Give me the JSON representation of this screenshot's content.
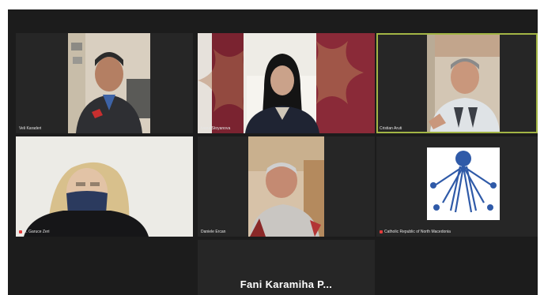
{
  "participants": [
    {
      "name": "Veli Karaderi",
      "muted": false
    },
    {
      "name": "Ivana Stoyanova",
      "muted": false
    },
    {
      "name": "Cristian Aruti",
      "muted": false
    },
    {
      "name": "A. Garuce Zeri",
      "muted": true
    },
    {
      "name": "Daniele Ercan",
      "muted": false
    },
    {
      "name": "Catholic Republic of North Macedonia",
      "muted": true
    }
  ],
  "active_speaker": "Fani Karamiha P...",
  "colors": {
    "background": "#1c1c1c",
    "tile": "#262626",
    "active_border": "#a3b545"
  }
}
